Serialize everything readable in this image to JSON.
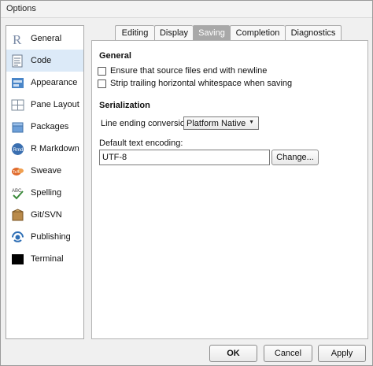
{
  "window": {
    "title": "Options"
  },
  "sidebar": {
    "items": [
      {
        "label": "General",
        "icon": "r-logo-icon"
      },
      {
        "label": "Code",
        "icon": "code-icon",
        "selected": true
      },
      {
        "label": "Appearance",
        "icon": "appearance-icon"
      },
      {
        "label": "Pane Layout",
        "icon": "pane-layout-icon"
      },
      {
        "label": "Packages",
        "icon": "packages-icon"
      },
      {
        "label": "R Markdown",
        "icon": "r-markdown-icon"
      },
      {
        "label": "Sweave",
        "icon": "sweave-icon"
      },
      {
        "label": "Spelling",
        "icon": "spelling-icon"
      },
      {
        "label": "Git/SVN",
        "icon": "git-svn-icon"
      },
      {
        "label": "Publishing",
        "icon": "publishing-icon"
      },
      {
        "label": "Terminal",
        "icon": "terminal-icon"
      }
    ]
  },
  "tabs": [
    {
      "label": "Editing"
    },
    {
      "label": "Display"
    },
    {
      "label": "Saving",
      "active": true
    },
    {
      "label": "Completion"
    },
    {
      "label": "Diagnostics"
    }
  ],
  "general": {
    "title": "General",
    "ensure_newline": {
      "label": "Ensure that source files end with newline",
      "checked": false
    },
    "strip_whitespace": {
      "label": "Strip trailing horizontal whitespace when saving",
      "checked": false
    }
  },
  "serialization": {
    "title": "Serialization",
    "line_ending_label": "Line ending conversion:",
    "line_ending_value": "Platform Native",
    "encoding_label": "Default text encoding:",
    "encoding_value": "UTF-8",
    "change_button": "Change..."
  },
  "footer": {
    "ok": "OK",
    "cancel": "Cancel",
    "apply": "Apply"
  }
}
